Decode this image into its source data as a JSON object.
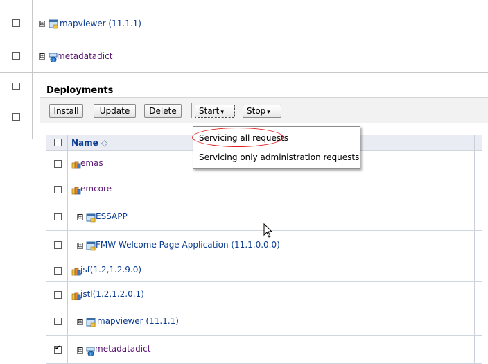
{
  "background_rows": [
    {
      "label": "mapviewer (11.1.1)",
      "expander": "⊞",
      "icon": "window-app-icon",
      "visited": false
    },
    {
      "label": "metadatadict",
      "expander": "⊞",
      "icon": "metadata-app-icon",
      "visited": true
    }
  ],
  "panel": {
    "title": "Deployments",
    "buttons": {
      "install": "Install",
      "update": "Update",
      "delete": "Delete",
      "start": "Start",
      "stop": "Stop"
    },
    "dropdown_arrow": "▾"
  },
  "table": {
    "header": {
      "name": "Name",
      "sort_indicator": "◇"
    },
    "rows": [
      {
        "label": "emas",
        "icon": "ear-app-icon",
        "expander": "",
        "checked": false,
        "visited": true
      },
      {
        "label": "emcore",
        "icon": "ear-app-icon",
        "expander": "",
        "checked": false,
        "visited": true
      },
      {
        "label": "ESSAPP",
        "icon": "window-app-icon",
        "expander": "⊞",
        "checked": false,
        "visited": false
      },
      {
        "label": "FMW Welcome Page Application (11.1.0.0.0)",
        "icon": "window-app-icon",
        "expander": "⊞",
        "checked": false,
        "visited": false
      },
      {
        "label": "jsf(1.2,1.2.9.0)",
        "icon": "ear-app-icon",
        "expander": "",
        "checked": false,
        "visited": false
      },
      {
        "label": "jstl(1.2,1.2.0.1)",
        "icon": "ear-app-icon",
        "expander": "",
        "checked": false,
        "visited": false
      },
      {
        "label": "mapviewer (11.1.1)",
        "icon": "window-app-icon",
        "expander": "⊞",
        "checked": false,
        "visited": false
      },
      {
        "label": "metadatadict",
        "icon": "metadata-app-icon",
        "expander": "⊞",
        "checked": true,
        "visited": true
      }
    ]
  },
  "start_menu": {
    "items": [
      "Servicing all requests",
      "Servicing only administration requests"
    ],
    "highlight_color": "#e02020"
  },
  "colors": {
    "link": "#0b3d91",
    "visited": "#5a1472",
    "toolbar_bg": "#f2f2f2",
    "header_bg": "#e9edf3"
  }
}
